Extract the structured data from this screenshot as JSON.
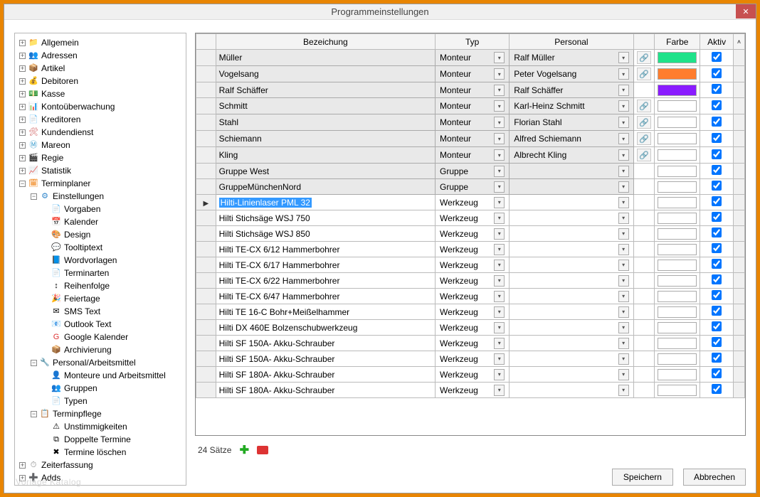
{
  "window": {
    "title": "Programmeinstellungen"
  },
  "watermark": "Vorlage Katalog",
  "tree": [
    {
      "label": "Allgemein",
      "exp": "+",
      "icon": "📁",
      "color": "#5a8"
    },
    {
      "label": "Adressen",
      "exp": "+",
      "icon": "👥",
      "color": "#8a5"
    },
    {
      "label": "Artikel",
      "exp": "+",
      "icon": "📦",
      "color": "#c93"
    },
    {
      "label": "Debitoren",
      "exp": "+",
      "icon": "💰",
      "color": "#cc3"
    },
    {
      "label": "Kasse",
      "exp": "+",
      "icon": "💵",
      "color": "#6b3"
    },
    {
      "label": "Kontoüberwachung",
      "exp": "+",
      "icon": "📊",
      "color": "#39c"
    },
    {
      "label": "Kreditoren",
      "exp": "+",
      "icon": "📄",
      "color": "#888"
    },
    {
      "label": "Kundendienst",
      "exp": "+",
      "icon": "🛠",
      "color": "#c55"
    },
    {
      "label": "Mareon",
      "exp": "+",
      "icon": "Ⓜ",
      "color": "#39c"
    },
    {
      "label": "Regie",
      "exp": "+",
      "icon": "🎬",
      "color": "#555"
    },
    {
      "label": "Statistik",
      "exp": "+",
      "icon": "📈",
      "color": "#39c"
    },
    {
      "label": "Terminplaner",
      "exp": "−",
      "icon": "🗓",
      "color": "#e70",
      "children": [
        {
          "label": "Einstellungen",
          "exp": "−",
          "icon": "⚙",
          "color": "#38c",
          "children": [
            {
              "label": "Vorgaben",
              "icon": "📄"
            },
            {
              "label": "Kalender",
              "icon": "📅"
            },
            {
              "label": "Design",
              "icon": "🎨"
            },
            {
              "label": "Tooltiptext",
              "icon": "💬"
            },
            {
              "label": "Wordvorlagen",
              "icon": "📘"
            },
            {
              "label": "Terminarten",
              "icon": "📄"
            },
            {
              "label": "Reihenfolge",
              "icon": "↕"
            },
            {
              "label": "Feiertage",
              "icon": "🎉"
            },
            {
              "label": "SMS Text",
              "icon": "✉"
            },
            {
              "label": "Outlook Text",
              "icon": "📧"
            },
            {
              "label": "Google Kalender",
              "icon": "G",
              "color": "#d33"
            },
            {
              "label": "Archivierung",
              "icon": "📦"
            }
          ]
        },
        {
          "label": "Personal/Arbeitsmittel",
          "exp": "−",
          "icon": "🔧",
          "color": "#c80",
          "children": [
            {
              "label": "Monteure und Arbeitsmittel",
              "icon": "👤"
            },
            {
              "label": "Gruppen",
              "icon": "👥"
            },
            {
              "label": "Typen",
              "icon": "📄"
            }
          ]
        },
        {
          "label": "Terminpflege",
          "exp": "−",
          "icon": "📋",
          "color": "#888",
          "children": [
            {
              "label": "Unstimmigkeiten",
              "icon": "⚠"
            },
            {
              "label": "Doppelte Termine",
              "icon": "⧉"
            },
            {
              "label": "Termine löschen",
              "icon": "✖"
            }
          ]
        }
      ]
    },
    {
      "label": "Zeiterfassung",
      "exp": "+",
      "icon": "⏱",
      "color": "#888"
    },
    {
      "label": "Adds",
      "exp": "+",
      "icon": "➕",
      "color": "#c55"
    }
  ],
  "grid": {
    "columns": {
      "bez": "Bezeichung",
      "typ": "Typ",
      "personal": "Personal",
      "farbe": "Farbe",
      "aktiv": "Aktiv"
    },
    "rows": [
      {
        "bez": "Müller",
        "typ": "Monteur",
        "pers": "Ralf Müller",
        "link": true,
        "color": "#1fe28a",
        "aktiv": true
      },
      {
        "bez": "Vogelsang",
        "typ": "Monteur",
        "pers": "Peter Vogelsang",
        "link": true,
        "color": "#ff7d2e",
        "aktiv": true
      },
      {
        "bez": "Ralf Schäffer",
        "typ": "Monteur",
        "pers": "Ralf Schäffer",
        "link": false,
        "color": "#8a1cff",
        "aktiv": true
      },
      {
        "bez": "Schmitt",
        "typ": "Monteur",
        "pers": "Karl-Heinz Schmitt",
        "link": true,
        "color": "",
        "aktiv": true
      },
      {
        "bez": "Stahl",
        "typ": "Monteur",
        "pers": "Florian Stahl",
        "link": true,
        "color": "",
        "aktiv": true
      },
      {
        "bez": "Schiemann",
        "typ": "Monteur",
        "pers": "Alfred Schiemann",
        "link": true,
        "color": "",
        "aktiv": true
      },
      {
        "bez": "Kling",
        "typ": "Monteur",
        "pers": "Albrecht Kling",
        "link": true,
        "color": "",
        "aktiv": true
      },
      {
        "bez": "Gruppe West",
        "typ": "Gruppe",
        "pers": "",
        "link": false,
        "color": "",
        "aktiv": true
      },
      {
        "bez": "GruppeMünchenNord",
        "typ": "Gruppe",
        "pers": "",
        "link": false,
        "color": "",
        "aktiv": true
      },
      {
        "bez": "Hilti-Linienlaser PML 32",
        "typ": "Werkzeug",
        "pers": "",
        "link": false,
        "color": "",
        "aktiv": true,
        "selected": true,
        "indicator": true
      },
      {
        "bez": "Hilti Stichsäge WSJ 750",
        "typ": "Werkzeug",
        "pers": "",
        "link": false,
        "color": "",
        "aktiv": true
      },
      {
        "bez": "Hilti Stichsäge WSJ 850",
        "typ": "Werkzeug",
        "pers": "",
        "link": false,
        "color": "",
        "aktiv": true
      },
      {
        "bez": "Hilti TE-CX 6/12 Hammerbohrer",
        "typ": "Werkzeug",
        "pers": "",
        "link": false,
        "color": "",
        "aktiv": true
      },
      {
        "bez": "Hilti TE-CX 6/17 Hammerbohrer",
        "typ": "Werkzeug",
        "pers": "",
        "link": false,
        "color": "",
        "aktiv": true
      },
      {
        "bez": "Hilti TE-CX 6/22 Hammerbohrer",
        "typ": "Werkzeug",
        "pers": "",
        "link": false,
        "color": "",
        "aktiv": true
      },
      {
        "bez": "Hilti TE-CX 6/47 Hammerbohrer",
        "typ": "Werkzeug",
        "pers": "",
        "link": false,
        "color": "",
        "aktiv": true
      },
      {
        "bez": "Hilti TE 16-C Bohr+Meißelhammer",
        "typ": "Werkzeug",
        "pers": "",
        "link": false,
        "color": "",
        "aktiv": true
      },
      {
        "bez": "Hilti DX 460E Bolzenschubwerkzeug",
        "typ": "Werkzeug",
        "pers": "",
        "link": false,
        "color": "",
        "aktiv": true
      },
      {
        "bez": "Hilti SF 150A- Akku-Schrauber",
        "typ": "Werkzeug",
        "pers": "",
        "link": false,
        "color": "",
        "aktiv": true
      },
      {
        "bez": "Hilti SF 150A- Akku-Schrauber",
        "typ": "Werkzeug",
        "pers": "",
        "link": false,
        "color": "",
        "aktiv": true
      },
      {
        "bez": "Hilti SF 180A- Akku-Schrauber",
        "typ": "Werkzeug",
        "pers": "",
        "link": false,
        "color": "",
        "aktiv": true
      },
      {
        "bez": "Hilti SF 180A- Akku-Schrauber",
        "typ": "Werkzeug",
        "pers": "",
        "link": false,
        "color": "",
        "aktiv": true
      }
    ],
    "count_label": "24 Sätze"
  },
  "buttons": {
    "save": "Speichern",
    "cancel": "Abbrechen"
  }
}
